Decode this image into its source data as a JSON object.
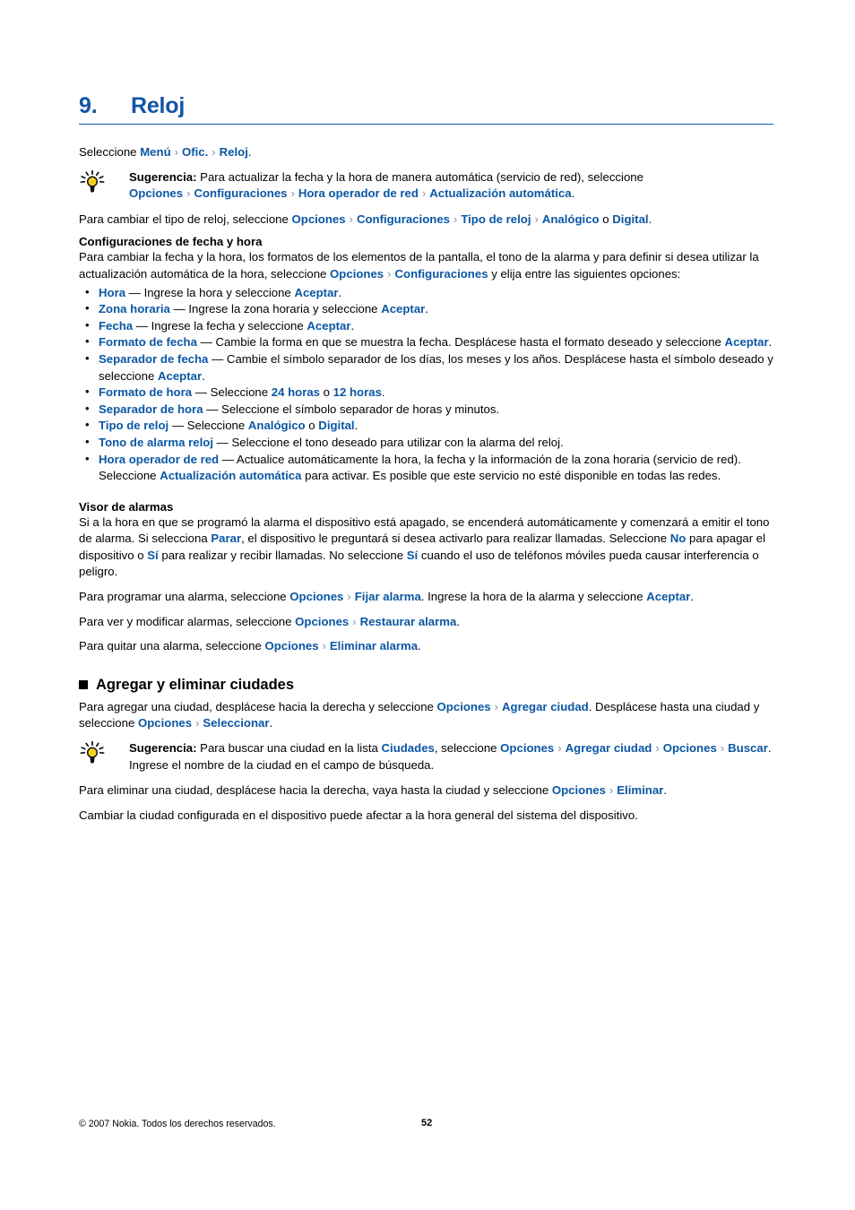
{
  "document": {
    "chapter_number": "9.",
    "chapter_title": "Reloj",
    "accent_color": "#1155a8",
    "link_color": "#0b57a4",
    "separator_glyph": "›"
  },
  "intro": {
    "lead": "Seleccione ",
    "path": [
      "Menú",
      "Ofic.",
      "Reloj"
    ],
    "trailing": "."
  },
  "tip1": {
    "icon": "lightbulb-tip-icon",
    "label": "Sugerencia:",
    "text1": " Para actualizar la fecha y la hora de manera automática (servicio de red), seleccione ",
    "link1": "Opciones",
    "link2": "Configuraciones",
    "link3": "Hora operador de red",
    "link4": "Actualización automática",
    "tail": "."
  },
  "clocktype": {
    "text1": "Para cambiar el tipo de reloj, seleccione ",
    "link1": "Opciones",
    "link2": "Configuraciones",
    "link3": "Tipo de reloj",
    "link4": "Analógico",
    "mid": " o ",
    "link5": "Digital",
    "tail": "."
  },
  "datetime": {
    "heading": "Configuraciones de fecha y hora",
    "text1": "Para cambiar la fecha y la hora, los formatos de los elementos de la pantalla, el tono de la alarma y para definir si desea utilizar la actualización automática de la hora, seleccione ",
    "link1": "Opciones",
    "link2": "Configuraciones",
    "tail": " y elija entre las siguientes opciones:"
  },
  "options_list": [
    {
      "term": "Hora",
      "dash": " — ",
      "text1": "Ingrese la hora y seleccione ",
      "link1": "Aceptar",
      "text2": ".",
      "link2": "",
      "text3": ""
    },
    {
      "term": "Zona horaria",
      "dash": " — ",
      "text1": "Ingrese la zona horaria y seleccione ",
      "link1": "Aceptar",
      "text2": ".",
      "link2": "",
      "text3": ""
    },
    {
      "term": "Fecha",
      "dash": " — ",
      "text1": "Ingrese la fecha y seleccione ",
      "link1": "Aceptar",
      "text2": ".",
      "link2": "",
      "text3": ""
    },
    {
      "term": "Formato de fecha",
      "dash": " — ",
      "text1": "Cambie la forma en que se muestra la fecha. Desplácese hasta el formato deseado y seleccione ",
      "link1": "Aceptar",
      "text2": ".",
      "link2": "",
      "text3": ""
    },
    {
      "term": "Separador de fecha",
      "dash": " — ",
      "text1": "Cambie el símbolo separador de los días, los meses y los años. Desplácese hasta el símbolo deseado y seleccione ",
      "link1": "Aceptar",
      "text2": ".",
      "link2": "",
      "text3": ""
    },
    {
      "term": "Formato de hora",
      "dash": " — ",
      "text1": "Seleccione ",
      "link1": "24 horas",
      "text2": " o ",
      "link2": "12 horas",
      "text3": "."
    },
    {
      "term": "Separador de hora",
      "dash": " — ",
      "text1": "Seleccione el símbolo separador de horas y minutos.",
      "link1": "",
      "text2": "",
      "link2": "",
      "text3": ""
    },
    {
      "term": "Tipo de reloj",
      "dash": " — ",
      "text1": "Seleccione ",
      "link1": "Analógico",
      "text2": " o ",
      "link2": "Digital",
      "text3": "."
    },
    {
      "term": "Tono de alarma reloj",
      "dash": " — ",
      "text1": "Seleccione el tono deseado para utilizar con la alarma del reloj.",
      "link1": "",
      "text2": "",
      "link2": "",
      "text3": ""
    },
    {
      "term": "Hora operador de red",
      "dash": " — ",
      "text1": "Actualice automáticamente la hora, la fecha y la información de la zona horaria (servicio de red). Seleccione ",
      "link1": "Actualización automática",
      "text2": " para activar. Es posible que este servicio no esté disponible en todas las redes.",
      "link2": "",
      "text3": ""
    }
  ],
  "alarms": {
    "heading": "Visor de alarmas",
    "p1_a": "Si a la hora en que se programó la alarma el dispositivo está apagado, se encenderá automáticamente y comenzará a emitir el tono de alarma. Si selecciona ",
    "p1_link1": "Parar",
    "p1_b": ", el dispositivo le preguntará si desea activarlo para realizar llamadas. Seleccione ",
    "p1_link2": "No",
    "p1_c": " para apagar el dispositivo o ",
    "p1_link3": "Sí",
    "p1_d": " para realizar y recibir llamadas. No seleccione ",
    "p1_link4": "Sí",
    "p1_e": " cuando el uso de teléfonos móviles pueda causar interferencia o peligro.",
    "p2_a": "Para programar una alarma, seleccione ",
    "p2_link1": "Opciones",
    "p2_link2": "Fijar alarma",
    "p2_b": ". Ingrese la hora de la alarma y seleccione ",
    "p2_link3": "Aceptar",
    "p2_c": ".",
    "p3_a": "Para ver y modificar alarmas, seleccione ",
    "p3_link1": "Opciones",
    "p3_link2": "Restaurar alarma",
    "p3_b": ".",
    "p4_a": "Para quitar una alarma, seleccione ",
    "p4_link1": "Opciones",
    "p4_link2": "Eliminar alarma",
    "p4_b": "."
  },
  "cities": {
    "heading": "Agregar y eliminar ciudades",
    "p1_a": "Para agregar una ciudad, desplácese hacia la derecha y seleccione ",
    "p1_link1": "Opciones",
    "p1_link2": "Agregar ciudad",
    "p1_b": ". Desplácese hasta una ciudad y seleccione ",
    "p1_link3": "Opciones",
    "p1_link4": "Seleccionar",
    "p1_c": ".",
    "tip": {
      "icon": "lightbulb-tip-icon",
      "label": "Sugerencia:",
      "text1": " Para buscar una ciudad en la lista ",
      "link1": "Ciudades",
      "text2": ", seleccione ",
      "link2": "Opciones",
      "link3": "Agregar ciudad",
      "link4": "Opciones",
      "link5": "Buscar",
      "text3": ". Ingrese el nombre de la ciudad en el campo de búsqueda."
    },
    "p2_a": "Para eliminar una ciudad, desplácese hacia la derecha, vaya hasta la ciudad y seleccione ",
    "p2_link1": "Opciones",
    "p2_link2": "Eliminar",
    "p2_b": ".",
    "p3": "Cambiar la ciudad configurada en el dispositivo puede afectar a la hora general del sistema del dispositivo."
  },
  "footer": {
    "copyright": "© 2007 Nokia. Todos los derechos reservados.",
    "page_number": "52"
  }
}
